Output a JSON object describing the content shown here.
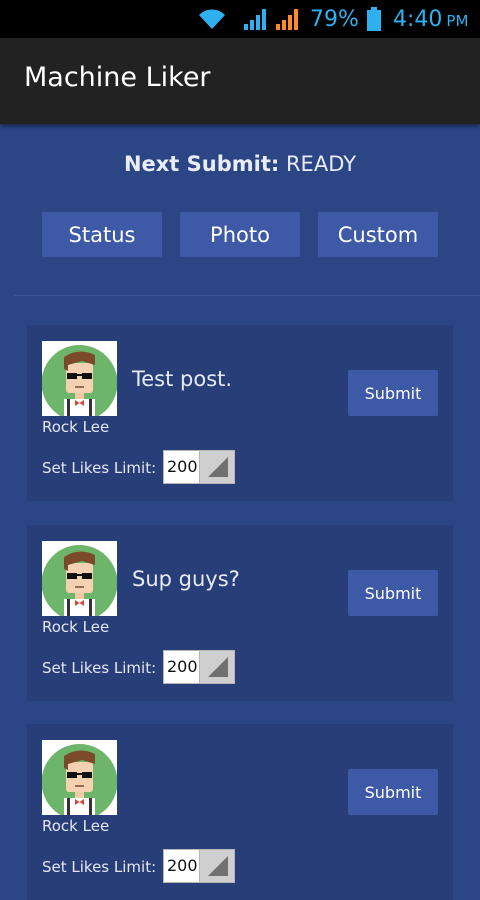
{
  "status_bar": {
    "battery_percent": "79%",
    "time": "4:40",
    "ampm": "PM",
    "accent_color": "#2fb0f0"
  },
  "app_bar": {
    "title": "Machine Liker"
  },
  "next_submit": {
    "label": "Next Submit:",
    "value": "READY"
  },
  "type_buttons": [
    "Status",
    "Photo",
    "Custom"
  ],
  "posts": [
    {
      "author": "Rock Lee",
      "text": "Test post.",
      "submit_label": "Submit",
      "limit_label": "Set Likes Limit:",
      "limit_value": "200"
    },
    {
      "author": "Rock Lee",
      "text": "Sup guys?",
      "submit_label": "Submit",
      "limit_label": "Set Likes Limit:",
      "limit_value": "200"
    },
    {
      "author": "Rock Lee",
      "text": "",
      "submit_label": "Submit",
      "limit_label": "Set Likes Limit:",
      "limit_value": "200"
    }
  ]
}
